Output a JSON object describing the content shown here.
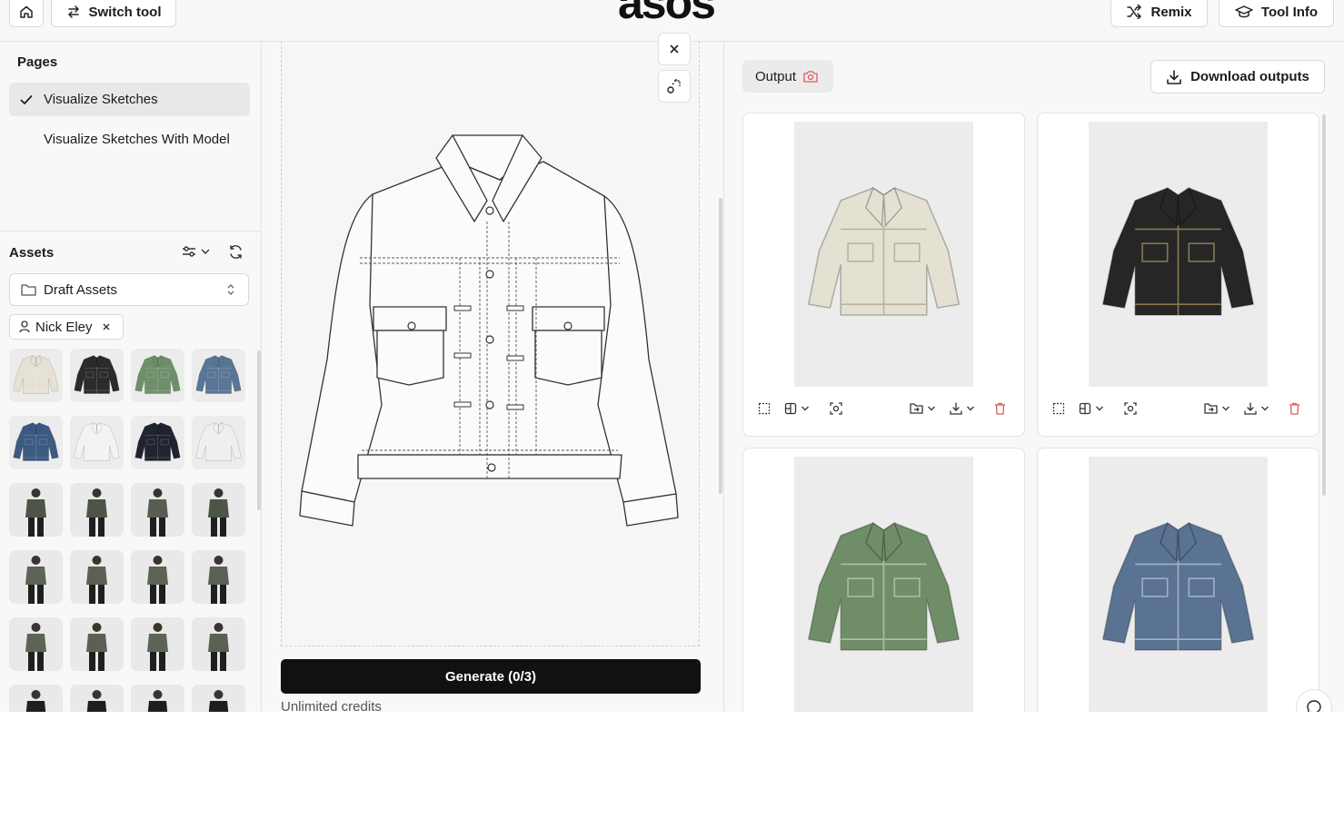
{
  "topbar": {
    "switch_tool_label": "Switch tool",
    "logo_text": "asos",
    "remix_label": "Remix",
    "tool_info_label": "Tool Info"
  },
  "sidebar": {
    "pages_title": "Pages",
    "pages": [
      {
        "label": "Visualize Sketches",
        "active": true
      },
      {
        "label": "Visualize Sketches With Model",
        "active": false
      }
    ],
    "assets_title": "Assets",
    "folder_select": "Draft Assets",
    "filter_chip": "Nick Eley",
    "thumbnails": [
      {
        "color": "#e6e2d3"
      },
      {
        "color": "#2b2b2b"
      },
      {
        "color": "#6e8f6a"
      },
      {
        "color": "#5a7595"
      },
      {
        "color": "#3c5a82"
      },
      {
        "color": "#f3f3f3"
      },
      {
        "color": "#1f2430"
      },
      {
        "color": "#efefef"
      },
      {
        "color": "#4c5547"
      },
      {
        "color": "#4c5547"
      },
      {
        "color": "#565d52"
      },
      {
        "color": "#4c5547"
      },
      {
        "color": "#5c6456"
      },
      {
        "color": "#5a6154"
      },
      {
        "color": "#5c6456"
      },
      {
        "color": "#5a6154"
      },
      {
        "color": "#5c6456"
      },
      {
        "color": "#5a6154"
      },
      {
        "color": "#5c6456"
      },
      {
        "color": "#5a6154"
      },
      {
        "color": "#1e1e1e"
      },
      {
        "color": "#1e1e1e"
      },
      {
        "color": "#1e1e1e"
      },
      {
        "color": "#1e1e1e"
      }
    ]
  },
  "editor": {
    "generate_label": "Generate  (0/3)",
    "credits_text": "Unlimited credits"
  },
  "output": {
    "tab_label": "Output",
    "download_label": "Download outputs",
    "cards": [
      {
        "jacket_color": "#e5e1d2",
        "stitch": "#b8b29f"
      },
      {
        "jacket_color": "#262626",
        "stitch": "#8a7a52"
      },
      {
        "jacket_color": "#6f8e68",
        "stitch": "#a9c1a0"
      },
      {
        "jacket_color": "#5a7393",
        "stitch": "#9fb2c9"
      }
    ]
  },
  "colors": {
    "accent_red": "#e05a5a",
    "generate_bg": "#111111"
  }
}
